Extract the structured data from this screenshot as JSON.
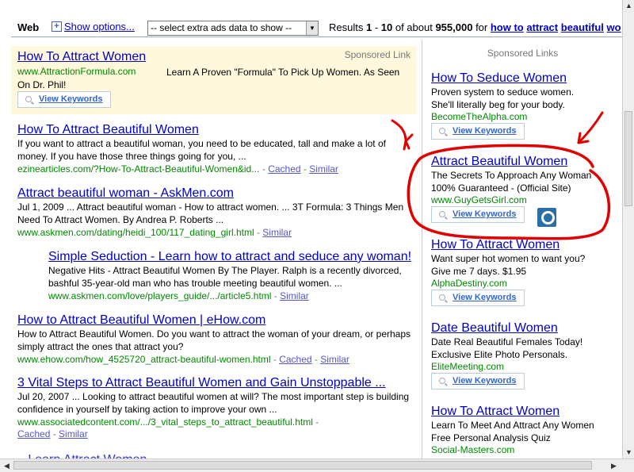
{
  "topbar": {
    "web": "Web",
    "show_options": "Show options...",
    "ads_select": "-- select extra ads data to show --",
    "results_prefix": "Results ",
    "r_from": "1",
    "r_dash": " - ",
    "r_to": "10",
    "r_of": " of about ",
    "r_total": "955,000",
    "r_for": " for ",
    "q1": "how to",
    "q2": "attract",
    "q3": "beautiful",
    "q4": "wo"
  },
  "view_keywords": "View Keywords",
  "sponsored_top": {
    "label": "Sponsored Link",
    "title": "How To Attract Women",
    "url": "www.AttractionFormula.com",
    "desc": "Learn A Proven \"Formula\" To Pick Up Women. As Seen On Dr. Phil!"
  },
  "results": [
    {
      "title": "How To Attract Beautiful Women",
      "snippet": "If you want to attract a beautiful woman, you need to be educated, tall and make a lot of money. If you have those three things going for you, ...",
      "url": "ezinearticles.com/?How-To-Attract-Beautiful-Women&id...",
      "cached": "Cached",
      "similar": "Similar"
    },
    {
      "title": "Attract beautiful woman - AskMen.com",
      "snippet": "Jul 1, 2009 ... Attract beautiful woman - How to attract women. ... 3T Formula: 3 Things Men Need To Attract Women. By Andrea P. Roberts ...",
      "url": "www.askmen.com/dating/heidi_100/117_dating_girl.html",
      "similar": "Similar"
    },
    {
      "title": "Simple Seduction - Learn how to attract and seduce any woman!",
      "snippet": "Negative Hits - Attract Beautiful Women By The Player. Ralph is a recently divorced, bashful 35-year-old man who has trouble meeting beautiful women. ...",
      "url": "www.askmen.com/love/players_guide/.../article5.html",
      "similar": "Similar"
    },
    {
      "title": "How to Attract Beautiful Women | eHow.com",
      "snippet": "How to Attract Beautiful Women. Do you want to attract the woman of your dream, or perhaps simply attract the ones that attract you?",
      "url": "www.ehow.com/how_4525720_attract-beautiful-women.html",
      "cached": "Cached",
      "similar": "Similar"
    },
    {
      "title": "3 Vital Steps to Attract Beautiful Women and Gain Unstoppable ...",
      "snippet": "Jul 20, 2007 ... Looking to attract beautiful women at will? The most important step is building confidence in yourself by taking action to improve your own ...",
      "url": "www.associatedcontent.com/.../3_vital_steps_to_attract_beautiful.html",
      "cached": "Cached",
      "similar": "Similar"
    }
  ],
  "cutoff_title": "...Learn Attract Women",
  "right_ads": {
    "label": "Sponsored Links",
    "ads": [
      {
        "title": "How To Seduce Women",
        "line1": "Proven system to seduce women.",
        "line2": "She'll literally beg for your body.",
        "url": "BecomeTheAlpha.com"
      },
      {
        "title": "Attract Beautiful Women",
        "line1": "The Secrets To Approach Any Woman",
        "line2": "100% Guaranteed - (Official Site)",
        "url": "www.GuyGetsGirl.com"
      },
      {
        "title": "How To Attract Women",
        "line1": "Want super hot women to want you?",
        "line2": "Give me 7 days. $1.95",
        "url": "AlphaDestiny.com"
      },
      {
        "title": "Date Beautiful Women",
        "line1": "Date Real Beautiful Females Today!",
        "line2": "Exclusive Elite Photo Personals.",
        "url": "EliteMeeting.com"
      },
      {
        "title": "How To Attract Women",
        "line1": "Learn To Meet And Attract Any Women",
        "line2": "Free Personal Analysis Quiz",
        "url": "Social-Masters.com"
      }
    ]
  },
  "colors": {
    "link": "#0000cc",
    "url": "#008000",
    "annotation": "#e00000",
    "ad_bg": "#fff8dd"
  }
}
